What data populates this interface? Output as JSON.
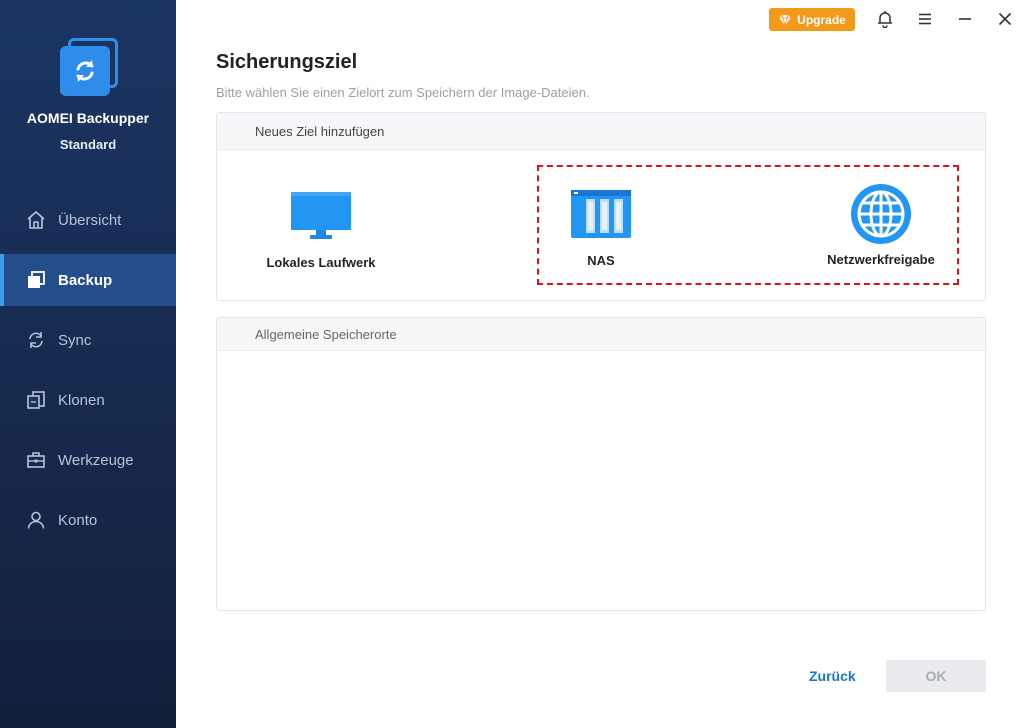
{
  "app": {
    "name": "AOMEI Backupper",
    "edition": "Standard"
  },
  "sidebar": {
    "items": [
      {
        "label": "Übersicht",
        "icon": "home-icon",
        "active": false
      },
      {
        "label": "Backup",
        "icon": "backup-icon",
        "active": true
      },
      {
        "label": "Sync",
        "icon": "sync-icon",
        "active": false
      },
      {
        "label": "Klonen",
        "icon": "clone-icon",
        "active": false
      },
      {
        "label": "Werkzeuge",
        "icon": "toolbox-icon",
        "active": false
      },
      {
        "label": "Konto",
        "icon": "user-icon",
        "active": false
      }
    ]
  },
  "titlebar": {
    "upgrade_label": "Upgrade"
  },
  "page": {
    "title": "Sicherungsziel",
    "subtitle": "Bitte wählen Sie einen Zielort zum Speichern der Image-Dateien."
  },
  "new_target": {
    "header": "Neues Ziel hinzufügen",
    "options": [
      {
        "label": "Lokales Laufwerk",
        "icon": "monitor-icon"
      },
      {
        "label": "NAS",
        "icon": "nas-icon"
      },
      {
        "label": "Netzwerkfreigabe",
        "icon": "globe-icon"
      }
    ]
  },
  "common_locations": {
    "header": "Allgemeine Speicherorte"
  },
  "footer": {
    "back_label": "Zurück",
    "ok_label": "OK"
  },
  "colors": {
    "sidebar_bg": "#1b3563",
    "active_item": "#254d8c",
    "accent": "#2e8cea",
    "upgrade": "#f39a1a",
    "highlight_border": "#e0131a"
  }
}
